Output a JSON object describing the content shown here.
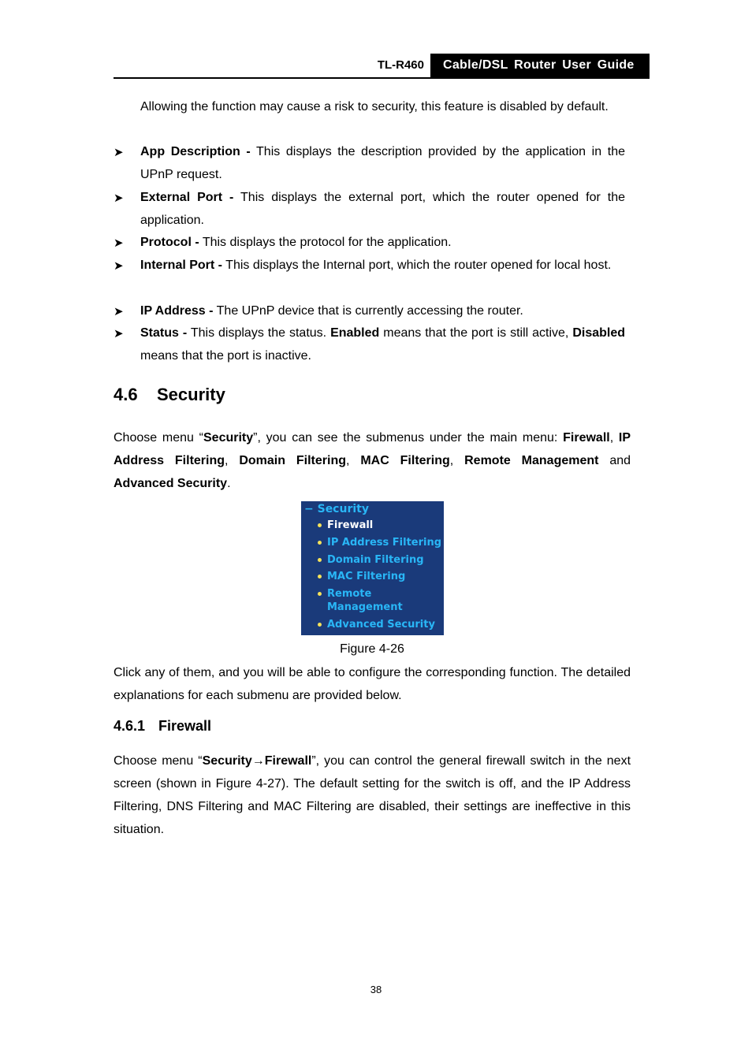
{
  "header": {
    "model": "TL-R460",
    "title": "Cable/DSL Router User Guide"
  },
  "intro": {
    "text": "Allowing the function may cause a risk to security, this feature is disabled by default."
  },
  "bullets": [
    {
      "term": "App Description -",
      "desc": " This displays the description provided by the application in the UPnP request."
    },
    {
      "term": "External Port -",
      "desc": " This displays the external port, which the router opened for the application."
    },
    {
      "term": "Protocol -",
      "desc": " This displays the protocol for the application."
    },
    {
      "term": "Internal Port -",
      "desc": " This displays the Internal port, which the router opened for local host."
    },
    {
      "term": "IP Address -",
      "desc": " The UPnP device that is currently accessing the router."
    },
    {
      "term": "Status -",
      "desc_a": " This displays the status. ",
      "b1": "Enabled",
      "desc_b": " means that the port is still active, ",
      "b2": "Disabled",
      "desc_c": " means that the port is inactive."
    }
  ],
  "section": {
    "number": "4.6",
    "title": "Security"
  },
  "section_para": {
    "a": "Choose menu “",
    "b1": "Security",
    "c": "”, you can see the submenus under the main menu: ",
    "b2": "Firewall",
    "d": ", ",
    "b3": "IP Address Filtering",
    "e": ", ",
    "b4": "Domain Filtering",
    "f": ", ",
    "b5": "MAC Filtering",
    "g": ", ",
    "b6": "Remote Management",
    "h": " and ",
    "b7": "Advanced Security",
    "i": "."
  },
  "menu": {
    "header": "− Security",
    "items": [
      "Firewall",
      "IP Address Filtering",
      "Domain Filtering",
      "MAC Filtering",
      "Remote",
      "Management",
      "Advanced Security"
    ],
    "colors": {
      "bg": "#1a3a7a",
      "link": "#29b6f6",
      "active": "#ffffff",
      "bullet": "#f5e25a"
    }
  },
  "caption": "Figure 4-26",
  "after_fig": "Click any of them, and you will be able to configure the corresponding function. The detailed explanations for each submenu are provided below.",
  "subsection": {
    "number": "4.6.1",
    "title": "Firewall"
  },
  "firewall_para": {
    "a": "Choose menu “",
    "b1": "Security→Firewall",
    "c": "”, you can control the general firewall switch in the next screen (shown in Figure 4-27). The default setting for the switch is off, and the IP Address Filtering, DNS Filtering and MAC Filtering are disabled, their settings are ineffective in this situation."
  },
  "page_number": "38"
}
